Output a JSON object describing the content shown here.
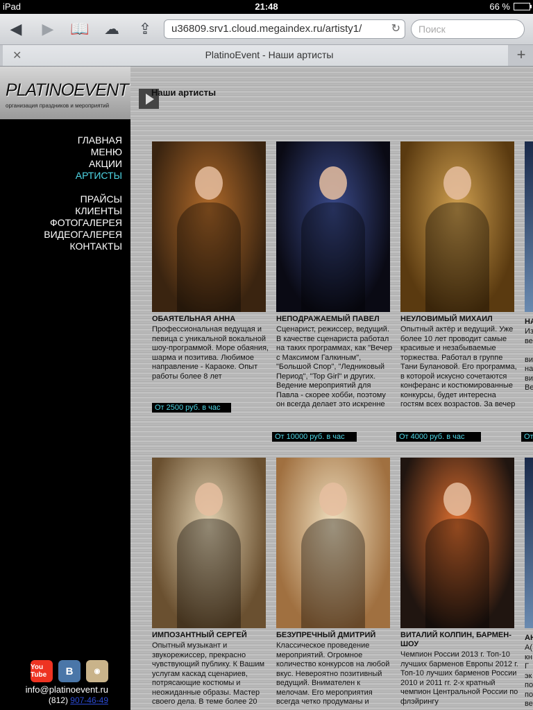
{
  "status": {
    "device": "iPad",
    "time": "21:48",
    "battery": "66 %",
    "battery_level": 0.66
  },
  "browser": {
    "url": "u36809.srv1.cloud.megaindex.ru/artisty1/",
    "search_placeholder": "Поиск",
    "tab_title": "PlatinoEvent - Наши артисты"
  },
  "logo": {
    "name": "PLATINOEVENT",
    "tagline": "организация праздников и мероприятий"
  },
  "nav": [
    {
      "label": "ГЛАВНАЯ",
      "active": false
    },
    {
      "label": "МЕНЮ",
      "active": false
    },
    {
      "label": "АКЦИИ",
      "active": false
    },
    {
      "label": "АРТИСТЫ",
      "active": true
    },
    {
      "label": "ПРАЙСЫ",
      "active": false
    },
    {
      "label": "КЛИЕНТЫ",
      "active": false
    },
    {
      "label": "ФОТОГАЛЕРЕЯ",
      "active": false
    },
    {
      "label": "ВИДЕОГАЛЕРЕЯ",
      "active": false
    },
    {
      "label": "КОНТАКТЫ",
      "active": false
    }
  ],
  "social": [
    {
      "icon": "youtube-icon",
      "label": "You Tube"
    },
    {
      "icon": "vk-icon",
      "label": "B"
    },
    {
      "icon": "instagram-icon",
      "label": "◉"
    }
  ],
  "contact": {
    "email": "info@platinoevent.ru",
    "phone_prefix": "(812)",
    "phone": "907-46-49"
  },
  "heading": "Наши артисты",
  "artists": [
    {
      "name": "ОБАЯТЕЛЬНАЯ АННА",
      "desc": "Профессиональная ведущая и певица с уникальной вокальной шоу-программой. Море обаяния, шарма и позитива. Любимое направление - Караоке. Опыт работы более 8 лет",
      "price": "От 2500 руб. в час",
      "colors": [
        "#3a2410",
        "#b06a2a"
      ]
    },
    {
      "name": "НЕПОДРАЖАЕМЫЙ ПАВЕЛ",
      "desc": "Сценарист, режиссер, ведущий. В качестве сценариста работал на таких программах, как \"Вечер с Максимом Галкиным\", \"Большой Спор\", \"Ледниковый Период\", \"Top Girl\" и других. Ведение мероприятий для Павла - скорее хобби, поэтому он всегда делает это искренне",
      "price": "От 10000 руб. в час",
      "colors": [
        "#0a0a14",
        "#3a4a8a"
      ]
    },
    {
      "name": "НЕУЛОВИМЫЙ МИХАИЛ",
      "desc": "Опытный актёр и ведущий. Уже более 10 лет проводит самые красивые и незабываемые торжества. Работал в группе Тани Булановой. Его программа, в которой искусно сочетаются конферанс и костюмированные конкурсы, будет интересна гостям всех возрастов. За вечер",
      "price": "От 4000 руб. в час",
      "colors": [
        "#5a3a10",
        "#d0a050"
      ]
    },
    {
      "name": "ИМПОЗАНТНЫЙ СЕРГЕЙ",
      "desc": "Опытный музыкант и звукорежиссер, прекрасно чувствующий публику. К Вашим услугам каскад сценариев, потрясающие костюмы и неожиданные образы. Мастер своего дела. В теме более 20",
      "price": "",
      "colors": [
        "#6a5030",
        "#e0d0b0"
      ]
    },
    {
      "name": "БЕЗУПРЕЧНЫЙ ДМИТРИЙ",
      "desc": "Классическое проведение мероприятий. Огромное количество конкурсов на любой вкус. Невероятно позитивный ведущий. Внимателен к мелочам. Его мероприятия всегда четко продуманы и",
      "price": "",
      "colors": [
        "#a07040",
        "#f0e0c0"
      ]
    },
    {
      "name": "ВИТАЛИЙ КОЛПИН, БАРМЕН-ШОУ",
      "desc": "Чемпион России 2013 г. Топ-10 лучших барменов Европы 2012 г. Топ-10 лучших барменов России 2010 и 2011 гг. 2-х кратный чемпион Центральной России по флэйрингу",
      "price": "",
      "colors": [
        "#201510",
        "#e07030"
      ]
    }
  ],
  "partial_col": {
    "name1": "НА",
    "lines1": [
      "Из",
      "ве",
      "",
      "ви",
      "на",
      "ви",
      "Ве"
    ],
    "price1": "От",
    "name2": "АН",
    "lines2": [
      "А(",
      "кн",
      "Г",
      "эк",
      "по",
      "по",
      "ве"
    ]
  }
}
